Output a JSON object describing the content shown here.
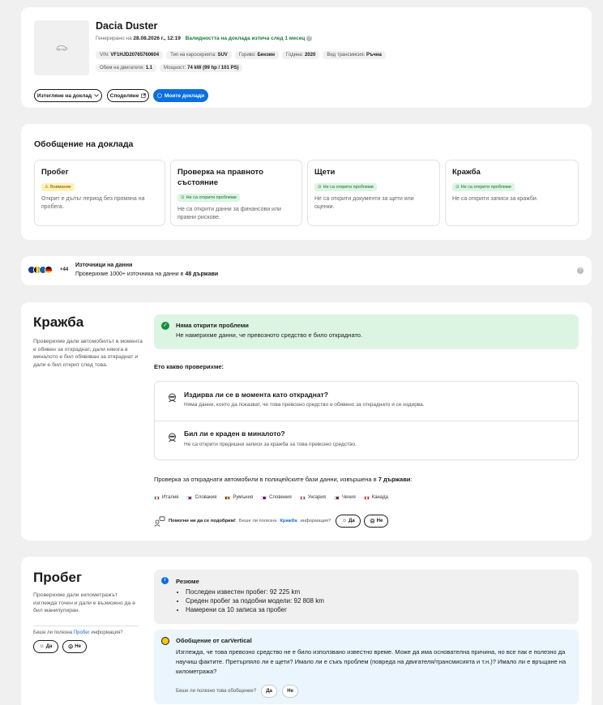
{
  "header": {
    "title": "Dacia Duster",
    "generated_prefix": "Генерирано на",
    "generated_date": "28.08.2026 г., 12:19",
    "validity": "Валидността на доклада изтича след 1 месец",
    "specs_row1": [
      {
        "label": "VIN:",
        "value": "VF1HJD20765760604"
      },
      {
        "label": "Тип на каросерията:",
        "value": "SUV"
      },
      {
        "label": "Гориво:",
        "value": "Бензин"
      },
      {
        "label": "Година:",
        "value": "2020"
      },
      {
        "label": "Вид трансмисия:",
        "value": "Ръчна"
      }
    ],
    "specs_row2": [
      {
        "label": "Обем на двигателя:",
        "value": "1.1"
      },
      {
        "label": "Мощност:",
        "value": "74 kW (99 hp / 101 PS)"
      }
    ],
    "buttons": {
      "view_report": "Изтегляне на доклад",
      "share": "Споделяне",
      "my_reports": "Моите доклади"
    }
  },
  "summary": {
    "title": "Обобщение на доклада",
    "boxes": [
      {
        "title": "Пробег",
        "tag": "Внимание",
        "tag_type": "warn",
        "text": "Открит е дълъг период без промяна на пробега."
      },
      {
        "title": "Проверка на правното състояние",
        "tag": "Не са открити проблеми",
        "tag_type": "ok",
        "text": "Не са открити данни за финансови или правни рискове."
      },
      {
        "title": "Щети",
        "tag": "Не са открити проблеми",
        "tag_type": "ok",
        "text": "Не са открити документи за щети или оценки."
      },
      {
        "title": "Кражба",
        "tag": "Не са открити проблеми",
        "tag_type": "ok",
        "text": "Не са открити записи за кражби."
      }
    ]
  },
  "sources": {
    "extra_count": "+44",
    "title": "Източници на данни",
    "text_prefix": "Проверихме 1000+ източника на данни в",
    "text_bold": "48 държави"
  },
  "theft": {
    "title": "Кражба",
    "description": "Проверихме дали автомобилът в момента е обявен за откраднат, дали някога в миналото е бил обявяван за откраднат и дали е бил открит след това.",
    "status_title": "Няма открити проблеми",
    "status_text": "Не намерихме данни, че превозното средство е било откраднато.",
    "checked_label": "Ето какво проверихме:",
    "checks": [
      {
        "title": "Издирва ли се в момента като откраднат?",
        "text": "Няма данни, които да показват, че това превозно средство е обявено за откраднато и се издирва."
      },
      {
        "title": "Бил ли е краден в миналото?",
        "text": "Не са открити предишни записи за кражба за това превозно средство."
      }
    ],
    "police_prefix": "Проверка за откраднати автомобили в полицейските бази данни, извършена в",
    "police_bold": "7 държави",
    "countries": [
      "Италия",
      "Словакия",
      "Румъния",
      "Словения",
      "Унгария",
      "Чехия",
      "Канада"
    ],
    "country_colors": [
      [
        "#009246",
        "#ffffff",
        "#ce2b37"
      ],
      [
        "#ffffff",
        "#0b4ea2",
        "#ee1c25"
      ],
      [
        "#002b7f",
        "#fcd116",
        "#ce1126"
      ],
      [
        "#ffffff",
        "#0000cc",
        "#ff0000"
      ],
      [
        "#cd2a3e",
        "#ffffff",
        "#436f4d"
      ],
      [
        "#ffffff",
        "#11457e",
        "#d7141a"
      ],
      [
        "#ff0000",
        "#ffffff",
        "#ff0000"
      ]
    ],
    "feedback_bold": "Помогни ни да се подобрим!",
    "feedback_text": "Беше ли полезна",
    "feedback_link": "Кражба",
    "feedback_suffix": "информация?",
    "yes": "Да",
    "no": "Не"
  },
  "mileage": {
    "title": "Пробег",
    "description": "Проверихме дали километражът изглежда точен и дали е възможно да е бил манипулиран.",
    "feedback_text": "Беше ли полезна",
    "feedback_link": "Пробег",
    "feedback_suffix": "информация?",
    "yes": "Да",
    "no": "Не",
    "summary_title": "Резюме",
    "summary_items": [
      "Последен известен пробег: 92 225 km",
      "Среден пробег за подобни модели: 92 808 km",
      "Намерени са 10 записа за пробег"
    ],
    "review_title": "Обобщение от carVertical",
    "review_text": "Изглежда, че това превозно средство не е било използвано известно време. Може да има основателна причина, но все пак е полезно да научиш фактите. Претърпяло ли е щети? Имало ли е съкъ проблем (повреда на двигателя/трансмисията и т.н.)? Имало ли е връщане на километража?",
    "review_question": "Беше ли полезно това обобщение?",
    "review_yes": "Да",
    "review_no": "Не"
  }
}
